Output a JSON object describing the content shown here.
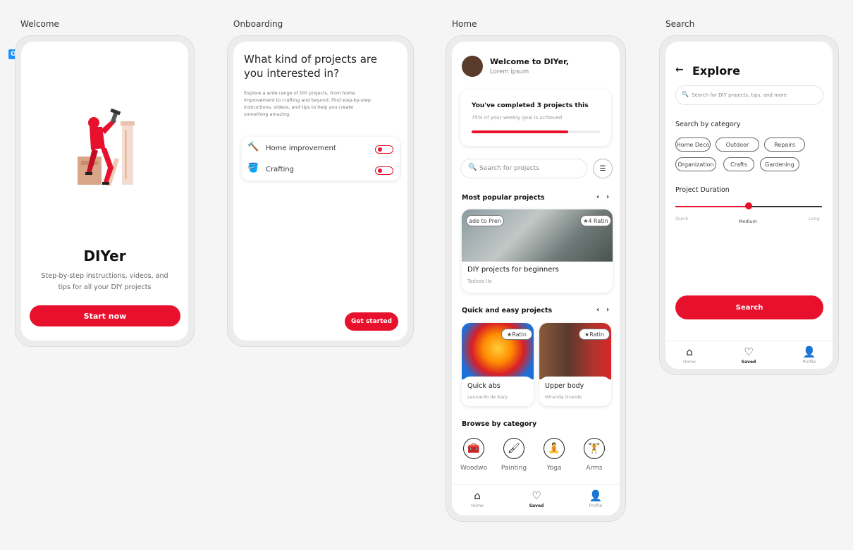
{
  "frames": {
    "welcome": "Welcome",
    "onboarding": "Onboarding",
    "home": "Home",
    "search": "Search"
  },
  "comment_badge": "O",
  "colors": {
    "accent": "#e8112d",
    "background": "#f5f5f5"
  },
  "welcome": {
    "title": "DIYer",
    "subtitle_line1": "Step-by-step instructions, videos, and",
    "subtitle_line2": "tips for all your DIY projects",
    "start_label": "Start now"
  },
  "onboarding": {
    "question_line1": "What kind of projects are",
    "question_line2": "you interested in?",
    "description_lines": [
      "Explore a wide range of DIY projects, from home",
      "improvement to crafting and beyond. Find step-by-step",
      "instructions, videos, and tips to help you create",
      "something amazing."
    ],
    "options": [
      {
        "icon": "hammer-icon",
        "label": "Home improvement",
        "enabled": true
      },
      {
        "icon": "paint-bucket-icon",
        "label": "Crafting",
        "enabled": true
      }
    ],
    "get_started_label": "Get started"
  },
  "home": {
    "greeting": "Welcome to DIYer,",
    "user_sub": "Lorem ipsum",
    "progress_title": "You've completed 3 projects this",
    "progress_sub": "75% of your weekly goal is achieved",
    "progress_value": 0.75,
    "search_placeholder": "Search for projects",
    "popular_heading": "Most popular projects",
    "featured": {
      "badge_left": "ade to Pren",
      "badge_right": "4 Ratin",
      "title": "DIY projects for beginners",
      "author": "Tadeas Ilo"
    },
    "quick_heading": "Quick and easy projects",
    "quick_cards": [
      {
        "badge": "Ratin",
        "title": "Quick abs",
        "author": "Leonardo de Karp"
      },
      {
        "badge": "Ratin",
        "title": "Upper body",
        "author": "Miranda Grande"
      }
    ],
    "browse_heading": "Browse by category",
    "categories": [
      {
        "icon": "toolbox-icon",
        "label": "Woodwo"
      },
      {
        "icon": "paintbrush-icon",
        "label": "Painting"
      },
      {
        "icon": "yoga-icon",
        "label": "Yoga"
      },
      {
        "icon": "dumbbell-icon",
        "label": "Arms"
      }
    ]
  },
  "nav": {
    "home": "Home",
    "saved": "Saved",
    "profile": "Profile"
  },
  "search": {
    "title": "Explore",
    "placeholder": "Search for DIY projects, tips, and more",
    "category_heading": "Search by category",
    "chips": [
      "Home Deco",
      "Outdoor",
      "Repairs",
      "Organization",
      "Crafts",
      "Gardening"
    ],
    "duration_heading": "Project Duration",
    "duration_value": 0.5,
    "duration_labels": {
      "min": "Quick",
      "mid": "Medium",
      "max": "Long"
    },
    "search_label": "Search"
  }
}
